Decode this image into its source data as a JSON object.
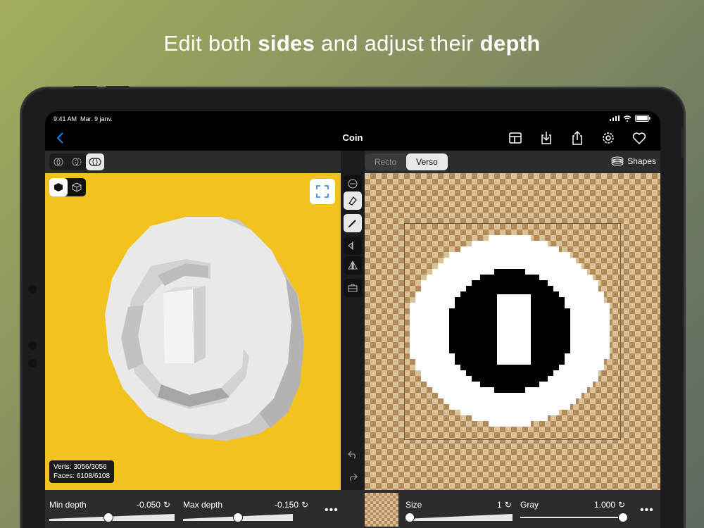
{
  "headline": {
    "part1": "Edit both ",
    "bold1": "sides",
    "part2": " and adjust their ",
    "bold2": "depth"
  },
  "status": {
    "time": "9:41 AM",
    "date": "Mar. 9 janv."
  },
  "nav": {
    "title": "Coin",
    "icons": [
      "back-chevron-icon",
      "layout-icon",
      "download-icon",
      "share-icon",
      "settings-icon",
      "heart-icon"
    ]
  },
  "left_toolbar": {
    "modes": [
      "front-side-icon",
      "back-side-icon",
      "both-sides-icon"
    ],
    "selected": 2
  },
  "right_toolbar": {
    "tabs": [
      "Recto",
      "Verso"
    ],
    "selected": "Verso",
    "shapes_label": "Shapes"
  },
  "viewport": {
    "background": "#f2c31f",
    "stats": {
      "verts": "Verts: 3056/3056",
      "faces": "Faces: 6108/6108"
    }
  },
  "tools": [
    "filter-icon",
    "brush-bucket-icon",
    "pencil-icon",
    "mirror-horizontal-icon",
    "mirror-vertical-icon",
    "toolbox-icon",
    "undo-icon",
    "redo-icon"
  ],
  "sliders": {
    "min_depth": {
      "label": "Min depth",
      "value": "-0.050"
    },
    "max_depth": {
      "label": "Max depth",
      "value": "-0.150"
    },
    "size": {
      "label": "Size",
      "value": "1"
    },
    "gray": {
      "label": "Gray",
      "value": "1.000"
    }
  }
}
